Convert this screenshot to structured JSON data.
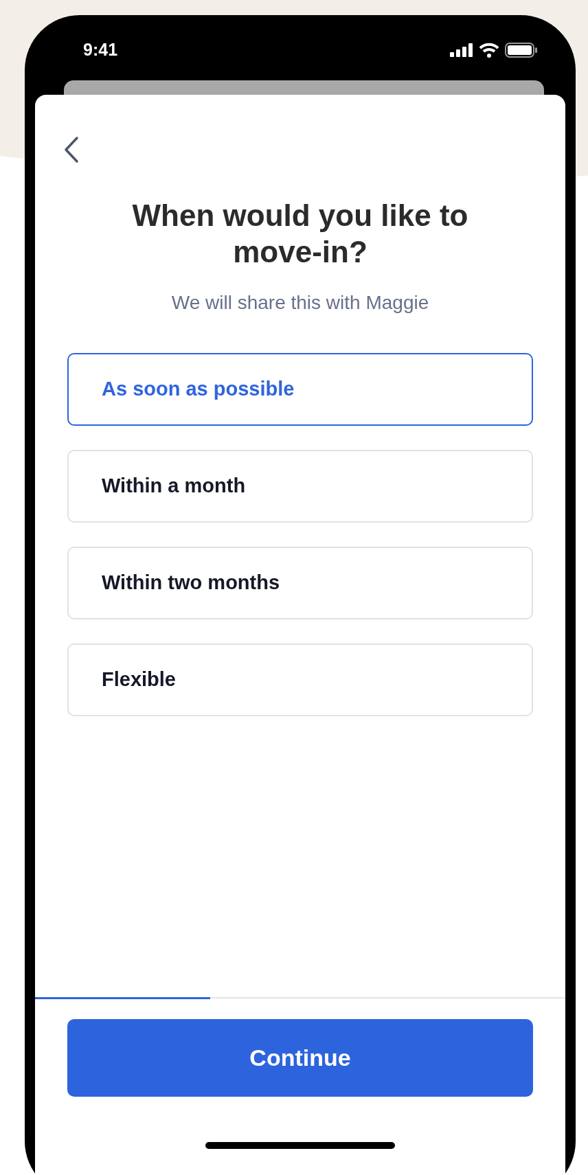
{
  "status_bar": {
    "time": "9:41"
  },
  "header": {
    "title": "When would you like to move-in?",
    "subtitle": "We will share this with Maggie"
  },
  "options": [
    {
      "label": "As soon as possible",
      "selected": true
    },
    {
      "label": "Within a month",
      "selected": false
    },
    {
      "label": "Within two months",
      "selected": false
    },
    {
      "label": "Flexible",
      "selected": false
    }
  ],
  "progress": {
    "level": 0.33
  },
  "continue_button": {
    "label": "Continue"
  }
}
